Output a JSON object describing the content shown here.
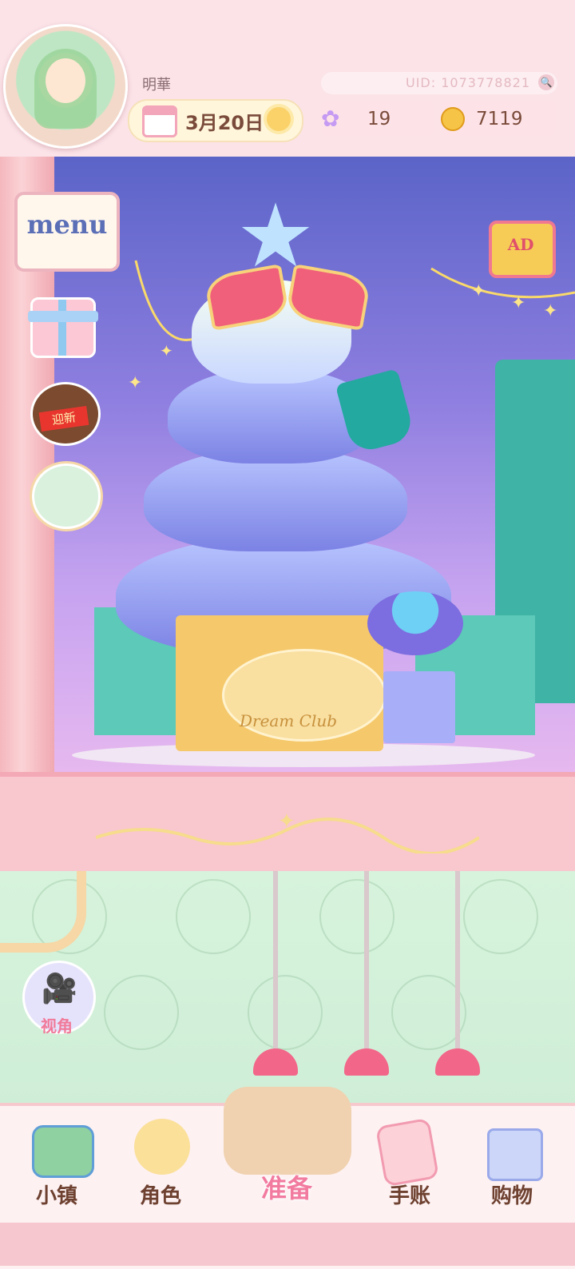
{
  "header": {
    "player_name": "明華",
    "uid": "UID: 1073778821",
    "date": "3月20日",
    "gems": "19",
    "coins": "7119"
  },
  "side_buttons": {
    "menu_label": "menu",
    "newyear_label": "迎新",
    "ad_label": "AD"
  },
  "scene": {
    "gift_box_label": "Dream Club"
  },
  "camera": {
    "label": "视角"
  },
  "nav": {
    "items": [
      {
        "label": "小镇"
      },
      {
        "label": "角色"
      },
      {
        "label": "准备"
      },
      {
        "label": "手账"
      },
      {
        "label": "购物"
      }
    ],
    "active": "准备"
  },
  "colors": {
    "accent_pink": "#f4a9b6",
    "nav_text": "#6e4130",
    "active_nav_text": "#f27ba0"
  }
}
